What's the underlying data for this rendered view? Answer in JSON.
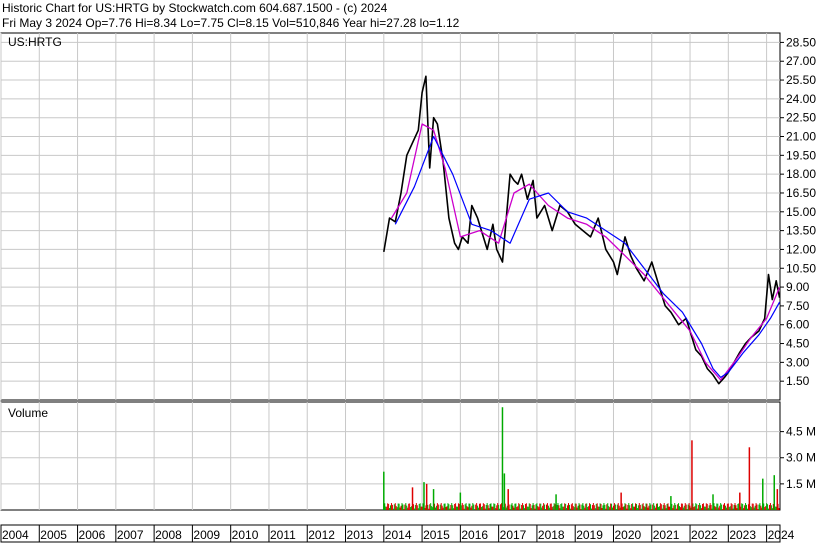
{
  "header": {
    "line1": "Historic Chart for US:HRTG by Stockwatch.com 604.687.1500 - (c) 2024",
    "line2": "Fri May  3 2024   Op=7.76  Hi=8.34  Lo=7.75  Cl=8.15  Vol=510,846   Year hi=27.28   lo=1.12"
  },
  "chart_data": [
    {
      "type": "line",
      "symbol": "US:HRTG",
      "title": "",
      "xlabel": "",
      "ylabel": "",
      "ylim": [
        0,
        29.25
      ],
      "yticks": [
        1.5,
        3.0,
        4.5,
        6.0,
        7.5,
        9.0,
        10.5,
        12.0,
        13.5,
        15.0,
        16.5,
        18.0,
        19.5,
        21.0,
        22.5,
        24.0,
        25.5,
        27.0,
        28.5
      ],
      "ytick_labels": [
        "1.50",
        "3.00",
        "4.50",
        "6.00",
        "7.50",
        "9.00",
        "10.50",
        "12.00",
        "13.50",
        "15.00",
        "16.50",
        "18.00",
        "19.50",
        "21.00",
        "22.50",
        "24.00",
        "25.50",
        "27.00",
        "28.50"
      ],
      "x_unit": "year",
      "xlim": [
        2004.0,
        2024.35
      ],
      "grid": true,
      "colors": {
        "price": "#000000",
        "ma_short": "#cc00cc",
        "ma_long": "#0000ff"
      },
      "series": [
        {
          "x": [
            2014.0,
            2014.15,
            2014.3,
            2014.45,
            2014.6,
            2014.75,
            2014.9,
            2015.0,
            2015.1,
            2015.2,
            2015.3,
            2015.4,
            2015.45,
            2015.55,
            2015.7,
            2015.85,
            2015.95,
            2016.05,
            2016.2,
            2016.3,
            2016.45,
            2016.55,
            2016.7,
            2016.85,
            2016.95,
            2017.1,
            2017.2,
            2017.3,
            2017.4,
            2017.5,
            2017.6,
            2017.75,
            2017.9,
            2018.0,
            2018.2,
            2018.4,
            2018.6,
            2018.8,
            2019.0,
            2019.2,
            2019.4,
            2019.6,
            2019.8,
            2020.0,
            2020.1,
            2020.2,
            2020.3,
            2020.45,
            2020.6,
            2020.8,
            2021.0,
            2021.1,
            2021.2,
            2021.35,
            2021.5,
            2021.7,
            2021.9,
            2022.0,
            2022.15,
            2022.3,
            2022.45,
            2022.6,
            2022.75,
            2022.9,
            2023.0,
            2023.15,
            2023.3,
            2023.45,
            2023.6,
            2023.8,
            2023.95,
            2024.05,
            2024.15,
            2024.25,
            2024.34
          ],
          "y": [
            11.8,
            14.5,
            14.2,
            16.5,
            19.5,
            20.5,
            21.5,
            24.5,
            25.8,
            18.5,
            22.5,
            22.0,
            21.0,
            19.0,
            14.5,
            12.5,
            12.0,
            13.0,
            12.5,
            15.5,
            14.5,
            13.5,
            12.0,
            14.0,
            12.0,
            11.0,
            14.5,
            18.0,
            17.5,
            17.2,
            18.0,
            16.0,
            17.5,
            14.5,
            15.5,
            13.5,
            15.5,
            15.0,
            14.0,
            13.5,
            13.0,
            14.5,
            12.0,
            11.0,
            10.0,
            11.5,
            13.0,
            11.5,
            10.5,
            9.5,
            11.0,
            10.0,
            9.0,
            7.5,
            7.0,
            6.0,
            6.5,
            5.5,
            4.0,
            3.5,
            2.5,
            2.0,
            1.3,
            1.8,
            2.2,
            3.0,
            3.8,
            4.5,
            5.0,
            5.5,
            6.5,
            10.0,
            8.0,
            9.5,
            8.15
          ]
        },
        {
          "x": [
            2014.2,
            2014.6,
            2015.0,
            2015.3,
            2015.6,
            2016.0,
            2016.5,
            2017.0,
            2017.4,
            2017.8,
            2018.3,
            2018.8,
            2019.3,
            2019.8,
            2020.3,
            2020.8,
            2021.2,
            2021.6,
            2022.0,
            2022.4,
            2022.8,
            2023.2,
            2023.6,
            2024.0,
            2024.34
          ],
          "y": [
            14.5,
            16.5,
            22.0,
            21.5,
            18.5,
            13.0,
            13.5,
            12.5,
            16.5,
            17.2,
            15.5,
            14.5,
            14.0,
            13.0,
            11.5,
            10.0,
            8.5,
            7.0,
            5.5,
            3.0,
            1.6,
            3.2,
            5.0,
            6.5,
            9.0
          ]
        },
        {
          "x": [
            2014.3,
            2014.8,
            2015.3,
            2015.8,
            2016.3,
            2016.8,
            2017.3,
            2017.8,
            2018.3,
            2018.8,
            2019.3,
            2019.8,
            2020.3,
            2020.8,
            2021.3,
            2021.8,
            2022.3,
            2022.6,
            2022.8,
            2023.0,
            2023.4,
            2023.8,
            2024.1,
            2024.34
          ],
          "y": [
            14.0,
            17.0,
            21.0,
            18.0,
            14.0,
            13.5,
            12.5,
            16.0,
            16.5,
            15.0,
            14.5,
            13.5,
            12.5,
            10.5,
            8.5,
            7.0,
            4.5,
            2.5,
            1.8,
            2.2,
            3.8,
            5.2,
            6.5,
            7.8
          ]
        }
      ]
    },
    {
      "type": "bar",
      "title": "Volume",
      "ylim": [
        0,
        6.2
      ],
      "yticks": [
        1.5,
        3.0,
        4.5
      ],
      "ytick_labels": [
        "1.5 M",
        "3.0 M",
        "4.5 M"
      ],
      "xlim": [
        2004.0,
        2024.35
      ],
      "colors": {
        "up": "#00aa00",
        "down": "#dd0000"
      },
      "baseline_volume_m": 0.35,
      "spikes": [
        {
          "x": 2014.0,
          "v": 2.2,
          "color": "up"
        },
        {
          "x": 2014.75,
          "v": 1.3,
          "color": "down"
        },
        {
          "x": 2015.05,
          "v": 1.6,
          "color": "up"
        },
        {
          "x": 2015.12,
          "v": 1.5,
          "color": "down"
        },
        {
          "x": 2015.3,
          "v": 1.2,
          "color": "up"
        },
        {
          "x": 2016.0,
          "v": 1.0,
          "color": "up"
        },
        {
          "x": 2017.1,
          "v": 5.9,
          "color": "up"
        },
        {
          "x": 2017.15,
          "v": 2.1,
          "color": "up"
        },
        {
          "x": 2017.25,
          "v": 1.2,
          "color": "down"
        },
        {
          "x": 2018.5,
          "v": 0.9,
          "color": "up"
        },
        {
          "x": 2020.2,
          "v": 1.0,
          "color": "down"
        },
        {
          "x": 2021.5,
          "v": 0.8,
          "color": "up"
        },
        {
          "x": 2022.05,
          "v": 4.0,
          "color": "down"
        },
        {
          "x": 2022.6,
          "v": 0.9,
          "color": "up"
        },
        {
          "x": 2023.3,
          "v": 1.0,
          "color": "down"
        },
        {
          "x": 2023.55,
          "v": 3.6,
          "color": "down"
        },
        {
          "x": 2023.9,
          "v": 1.8,
          "color": "up"
        },
        {
          "x": 2024.2,
          "v": 2.0,
          "color": "up"
        },
        {
          "x": 2024.28,
          "v": 1.2,
          "color": "down"
        }
      ]
    }
  ],
  "price_panel_label": "US:HRTG",
  "volume_panel_label": "Volume",
  "x_axis_labels": [
    "2004",
    "2005",
    "2006",
    "2007",
    "2008",
    "2009",
    "2010",
    "2011",
    "2012",
    "2013",
    "2014",
    "2015",
    "2016",
    "2017",
    "2018",
    "2019",
    "2020",
    "2021",
    "2022",
    "2023",
    "2024"
  ]
}
